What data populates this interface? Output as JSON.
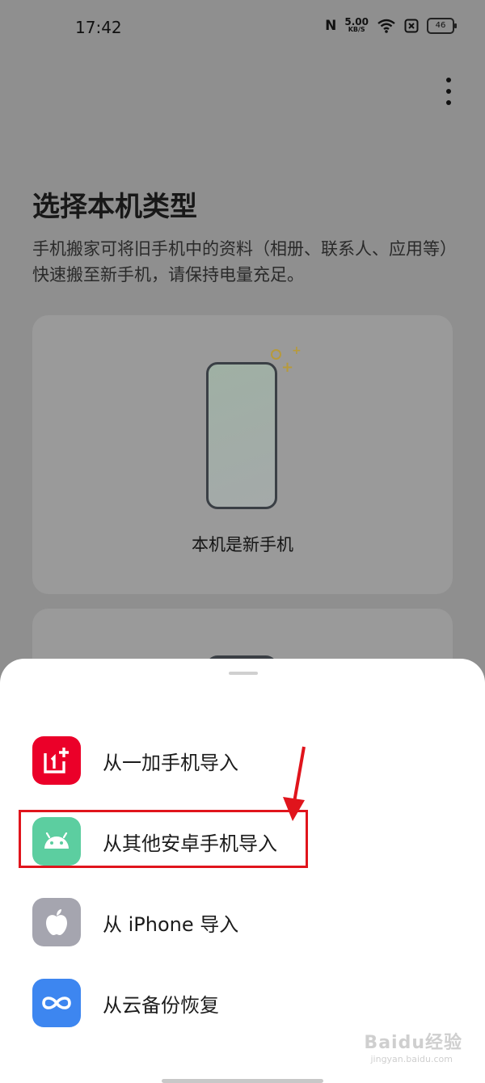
{
  "status_bar": {
    "time": "17:42",
    "nfc": "N",
    "net_speed": "5.00",
    "net_speed_unit": "KB/S",
    "battery": "46"
  },
  "header": {
    "title": "选择本机类型",
    "description": "手机搬家可将旧手机中的资料（相册、联系人、应用等）快速搬至新手机，请保持电量充足。"
  },
  "cards": {
    "new_phone_label": "本机是新手机"
  },
  "sheet": {
    "options": [
      {
        "label": "从一加手机导入",
        "icon": "oneplus-icon",
        "color": "#eb0029"
      },
      {
        "label": "从其他安卓手机导入",
        "icon": "android-icon",
        "color": "#5ccea0"
      },
      {
        "label": "从 iPhone 导入",
        "icon": "apple-icon",
        "color": "#a5a5af"
      },
      {
        "label": "从云备份恢复",
        "icon": "cloud-backup-icon",
        "color": "#3d86f0"
      }
    ]
  },
  "watermark": {
    "text": "Baidu经验",
    "sub": "jingyan.baidu.com"
  },
  "annotation": {
    "color": "#e0141c"
  }
}
